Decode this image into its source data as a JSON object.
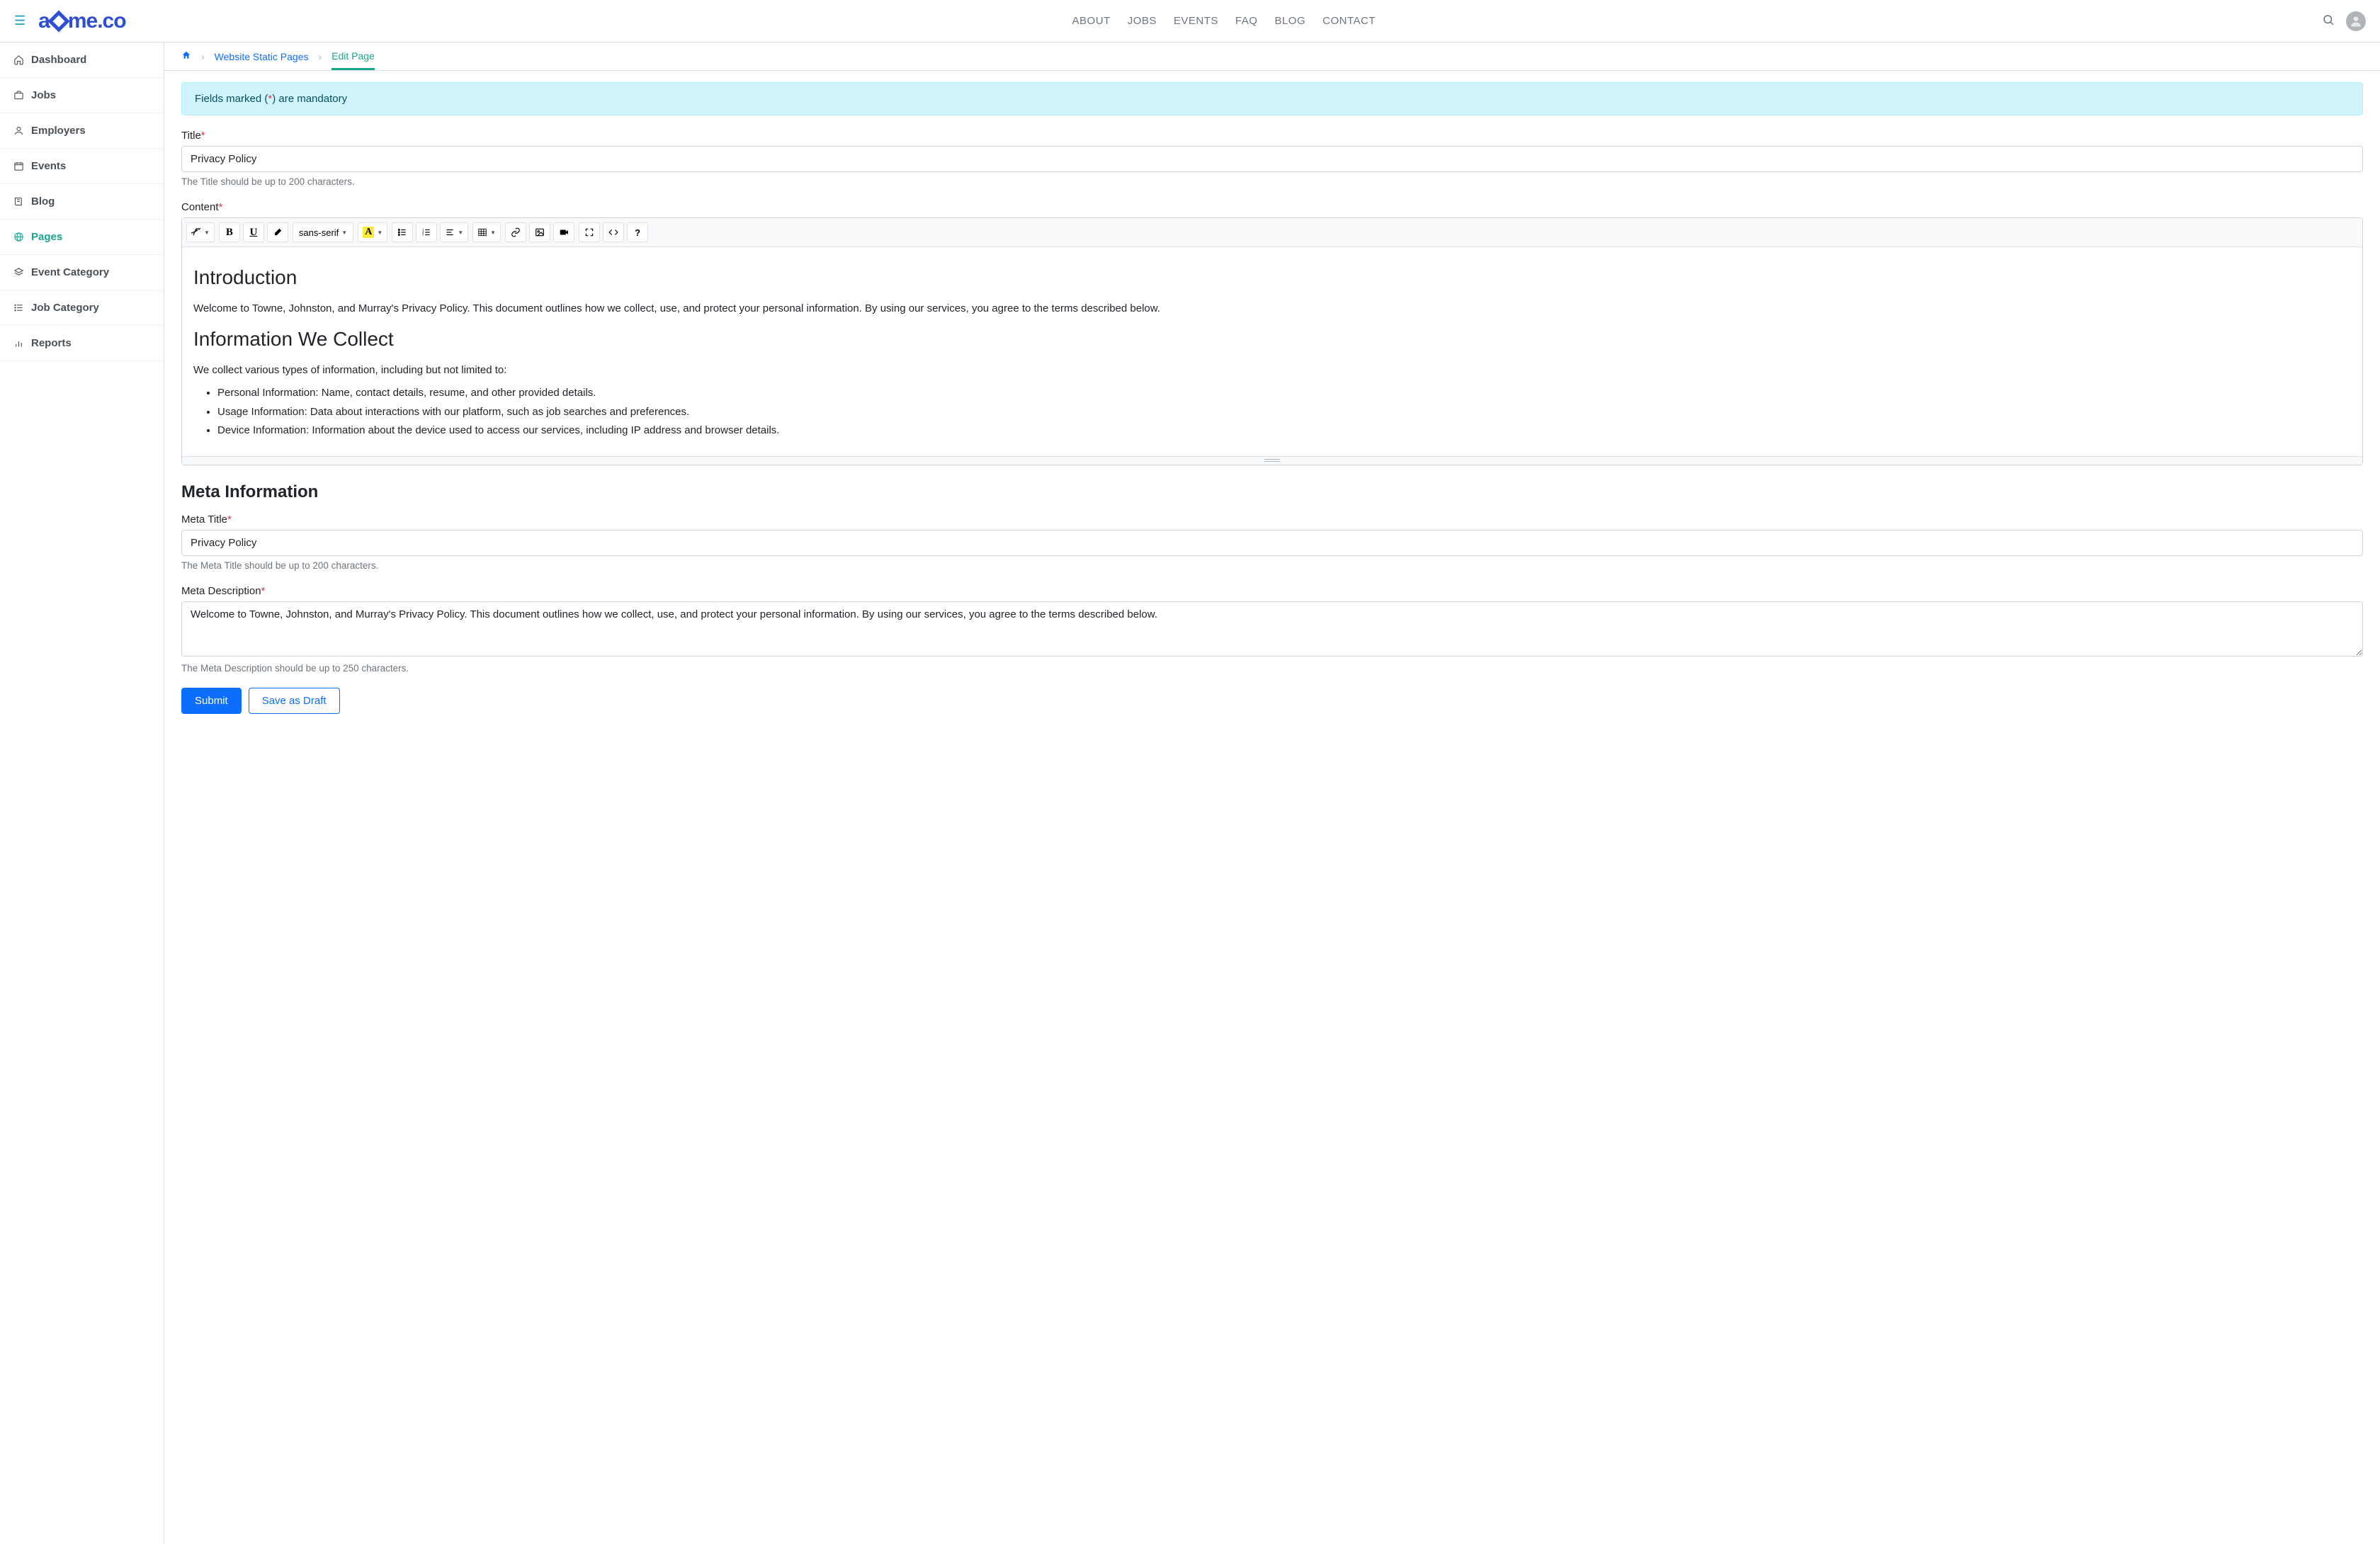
{
  "top": {
    "logo_a": "a",
    "logo_b": "me.co",
    "nav": [
      "ABOUT",
      "JOBS",
      "EVENTS",
      "FAQ",
      "BLOG",
      "CONTACT"
    ]
  },
  "sidebar": {
    "items": [
      {
        "label": "Dashboard"
      },
      {
        "label": "Jobs"
      },
      {
        "label": "Employers"
      },
      {
        "label": "Events"
      },
      {
        "label": "Blog"
      },
      {
        "label": "Pages"
      },
      {
        "label": "Event Category"
      },
      {
        "label": "Job Category"
      },
      {
        "label": "Reports"
      }
    ],
    "active_index": 5
  },
  "breadcrumb": {
    "level1": "Website Static Pages",
    "current": "Edit Page"
  },
  "alert": {
    "pre": "Fields marked (",
    "star": "*",
    "post": ") are mandatory"
  },
  "form": {
    "title_label": "Title",
    "title_value": "Privacy Policy",
    "title_hint": "The Title should be up to 200 characters.",
    "content_label": "Content",
    "font_family": "sans-serif",
    "editor": {
      "h1": "Introduction",
      "p1": "Welcome to Towne, Johnston, and Murray's Privacy Policy. This document outlines how we collect, use, and protect your personal information. By using our services, you agree to the terms described below.",
      "h2": "Information We Collect",
      "p2": "We collect various types of information, including but not limited to:",
      "li1": "Personal Information: Name, contact details, resume, and other provided details.",
      "li2": "Usage Information: Data about interactions with our platform, such as job searches and preferences.",
      "li3": "Device Information: Information about the device used to access our services, including IP address and browser details."
    },
    "meta_section": "Meta Information",
    "meta_title_label": "Meta Title",
    "meta_title_value": "Privacy Policy",
    "meta_title_hint": "The Meta Title should be up to 200 characters.",
    "meta_desc_label": "Meta Description",
    "meta_desc_value": "Welcome to Towne, Johnston, and Murray's Privacy Policy. This document outlines how we collect, use, and protect your personal information. By using our services, you agree to the terms described below.",
    "meta_desc_hint": "The Meta Description should be up to 250 characters.",
    "submit": "Submit",
    "save_draft": "Save as Draft"
  }
}
